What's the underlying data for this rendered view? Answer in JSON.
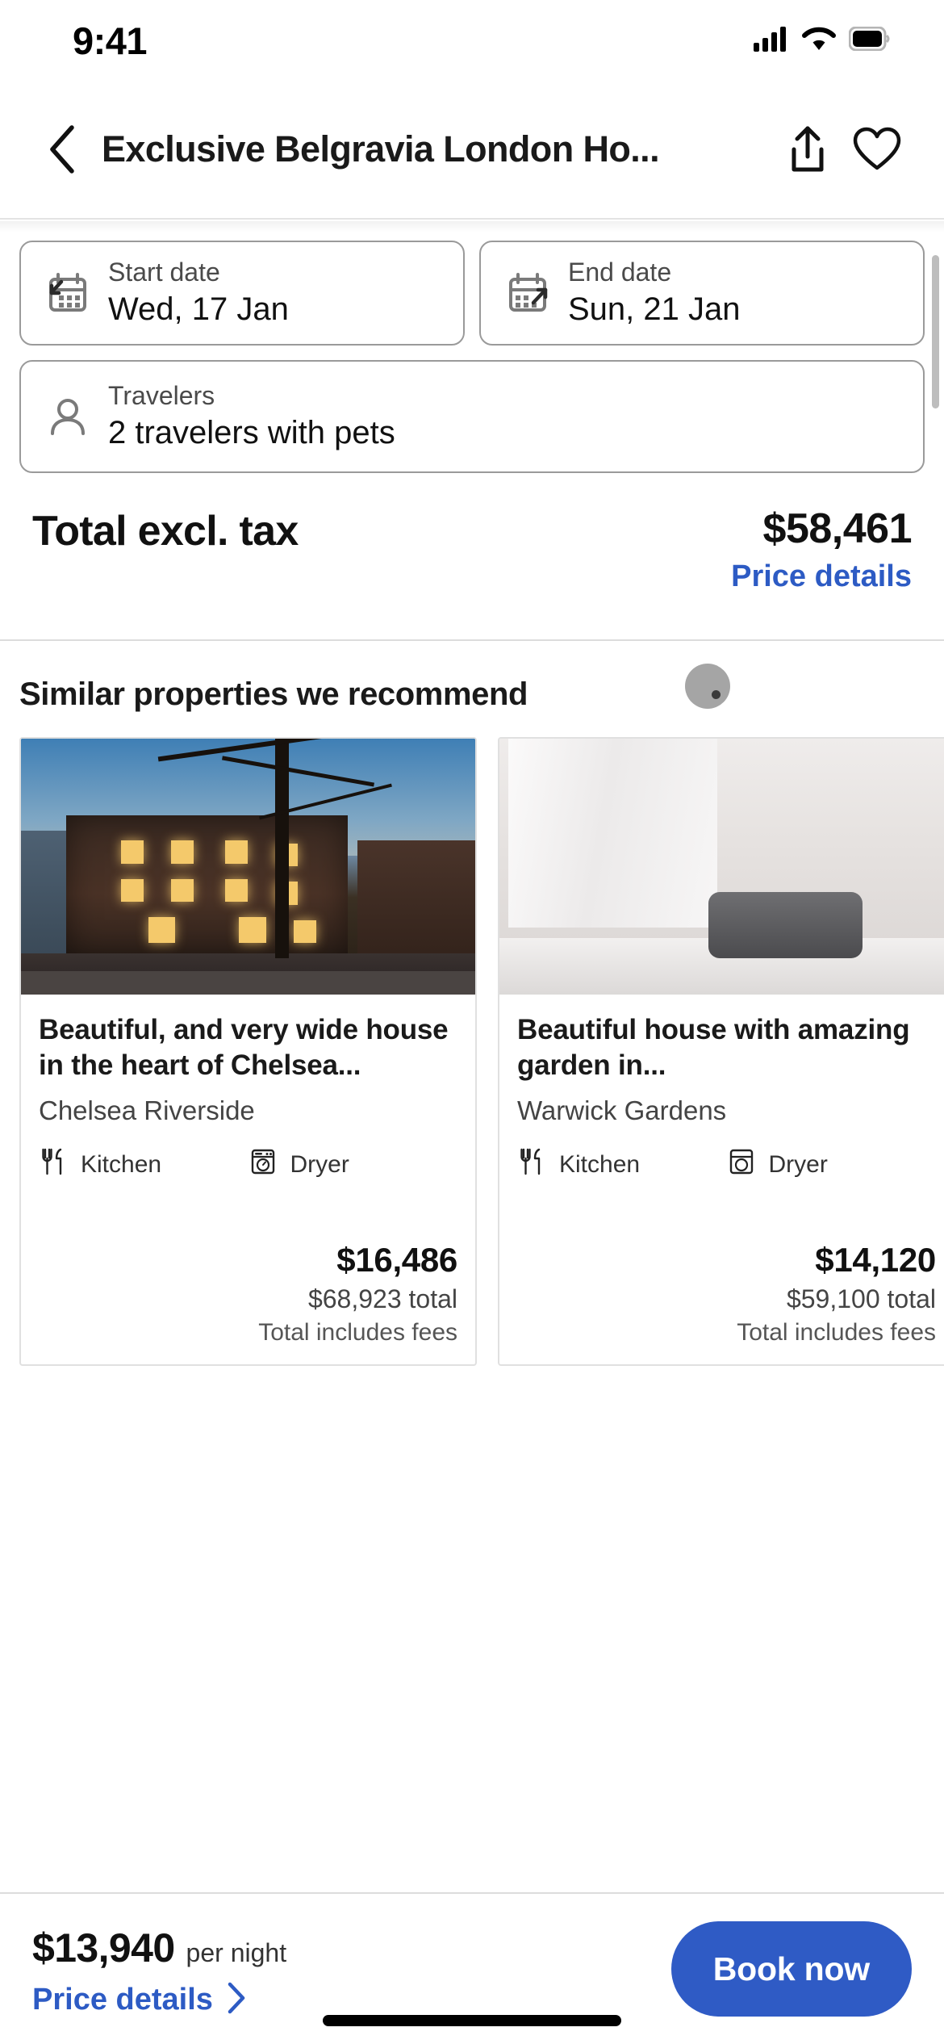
{
  "status_bar": {
    "time": "9:41",
    "cellular_icon": "cellular-bars-icon",
    "wifi_icon": "wifi-icon",
    "battery_icon": "battery-full-icon"
  },
  "nav_bar": {
    "back_icon": "chevron-left-icon",
    "title": "Exclusive Belgravia London Ho...",
    "share_icon": "share-icon",
    "favorite_icon": "heart-outline-icon"
  },
  "stay_form": {
    "start_date": {
      "icon": "calendar-arrow-in-icon",
      "label": "Start date",
      "value": "Wed, 17 Jan"
    },
    "end_date": {
      "icon": "calendar-arrow-out-icon",
      "label": "End date",
      "value": "Sun, 21 Jan"
    },
    "travelers": {
      "icon": "person-icon",
      "label": "Travelers",
      "value": "2 travelers with pets"
    }
  },
  "total": {
    "label": "Total excl. tax",
    "amount": "$58,461",
    "price_details_link": "Price details"
  },
  "similar": {
    "heading": "Similar properties we recommend",
    "cards": [
      {
        "photo": "london-townhouse-dusk-photo",
        "name": "Beautiful, and very wide house in the heart of Chelsea...",
        "area": "Chelsea Riverside",
        "amenities": [
          {
            "icon": "kitchen-icon",
            "label": "Kitchen"
          },
          {
            "icon": "dryer-icon",
            "label": "Dryer"
          }
        ],
        "price": "$16,486",
        "total": "$68,923 total",
        "taxes": "Total includes fees"
      },
      {
        "photo": "white-bedroom-curtains-photo",
        "name": "Beautiful house with amazing garden in...",
        "area": "Warwick Gardens",
        "amenities": [
          {
            "icon": "kitchen-icon",
            "label": "Kitchen"
          },
          {
            "icon": "dryer-icon",
            "label": "Dryer"
          }
        ],
        "price": "$14,120",
        "total": "$59,100 total",
        "taxes": "Total includes fees"
      }
    ]
  },
  "bottom_bar": {
    "price": "$13,940",
    "per_night": "per night",
    "price_details_link": "Price details",
    "price_details_chevron": "chevron-right-icon",
    "book_button": "Book now"
  },
  "colors": {
    "accent_blue": "#2f5bc5",
    "link_blue": "#2d5bc4",
    "text_primary": "#1a1a1a",
    "border_gray": "#9a9a9a"
  }
}
